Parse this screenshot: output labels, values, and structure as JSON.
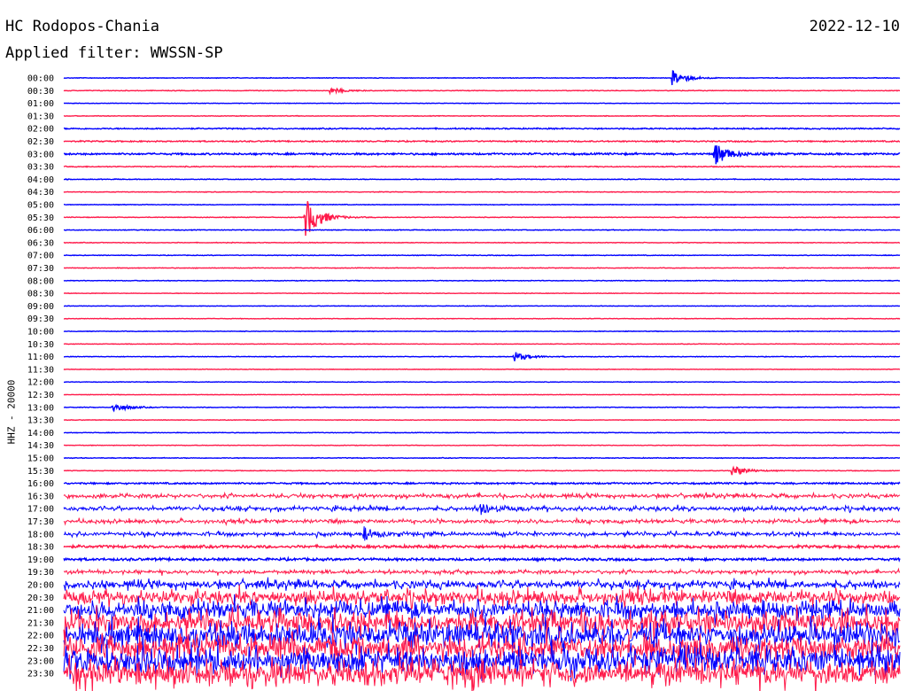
{
  "header": {
    "station": "HC Rodopos-Chania",
    "date": "2022-12-10",
    "filter": "Applied filter: WWSSN-SP"
  },
  "chart_data": {
    "type": "line",
    "channel_label": "HHZ - 20000",
    "trace_colors": [
      "#0000ff",
      "#ff1a4a"
    ],
    "row_labels": [
      "00:00",
      "00:30",
      "01:00",
      "01:30",
      "02:00",
      "02:30",
      "03:00",
      "03:30",
      "04:00",
      "04:30",
      "05:00",
      "05:30",
      "06:00",
      "06:30",
      "07:00",
      "07:30",
      "08:00",
      "08:30",
      "09:00",
      "09:30",
      "10:00",
      "10:30",
      "11:00",
      "11:30",
      "12:00",
      "12:30",
      "13:00",
      "13:30",
      "14:00",
      "14:30",
      "15:00",
      "15:30",
      "16:00",
      "16:30",
      "17:00",
      "17:30",
      "18:00",
      "18:30",
      "19:00",
      "19:30",
      "20:00",
      "20:30",
      "21:00",
      "21:30",
      "22:00",
      "22:30",
      "23:00",
      "23:30"
    ],
    "noise_level": [
      0.3,
      0.3,
      0.25,
      0.3,
      0.6,
      0.6,
      0.9,
      0.45,
      0.35,
      0.3,
      0.3,
      0.3,
      0.35,
      0.3,
      0.3,
      0.3,
      0.3,
      0.25,
      0.25,
      0.25,
      0.3,
      0.25,
      0.3,
      0.25,
      0.25,
      0.25,
      0.3,
      0.25,
      0.3,
      0.25,
      0.35,
      0.3,
      0.8,
      2.0,
      2.2,
      2.0,
      2.0,
      1.3,
      1.2,
      1.8,
      4.0,
      7,
      9,
      11,
      12,
      12,
      13,
      12
    ],
    "events": [
      {
        "row": 0,
        "x": 0.73,
        "amp": 8
      },
      {
        "row": 1,
        "x": 0.32,
        "amp": 3
      },
      {
        "row": 6,
        "x": 0.78,
        "amp": 12
      },
      {
        "row": 11,
        "x": 0.29,
        "amp": 22
      },
      {
        "row": 22,
        "x": 0.54,
        "amp": 5
      },
      {
        "row": 26,
        "x": 0.06,
        "amp": 5
      },
      {
        "row": 31,
        "x": 0.8,
        "amp": 6
      },
      {
        "row": 34,
        "x": 0.5,
        "amp": 6
      },
      {
        "row": 36,
        "x": 0.36,
        "amp": 6
      }
    ]
  }
}
